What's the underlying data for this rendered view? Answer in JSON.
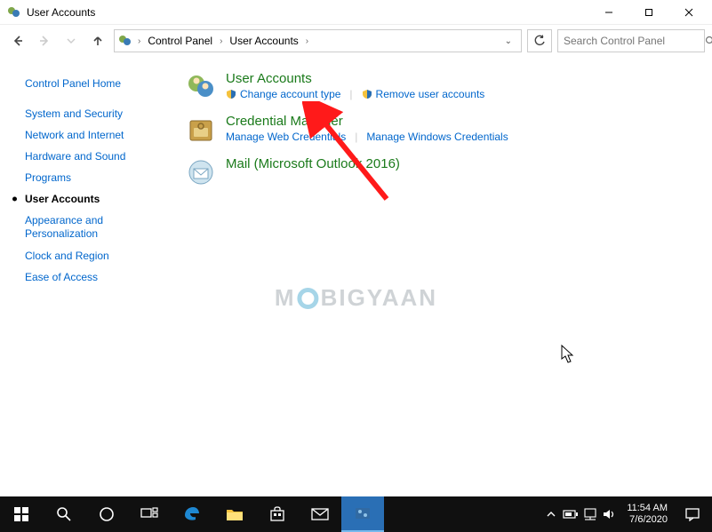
{
  "window": {
    "title": "User Accounts"
  },
  "nav": {
    "breadcrumb": [
      "Control Panel",
      "User Accounts"
    ],
    "search_placeholder": "Search Control Panel"
  },
  "sidebar": {
    "items": [
      {
        "label": "Control Panel Home",
        "current": false
      },
      {
        "label": "System and Security",
        "current": false
      },
      {
        "label": "Network and Internet",
        "current": false
      },
      {
        "label": "Hardware and Sound",
        "current": false
      },
      {
        "label": "Programs",
        "current": false
      },
      {
        "label": "User Accounts",
        "current": true
      },
      {
        "label": "Appearance and Personalization",
        "current": false
      },
      {
        "label": "Clock and Region",
        "current": false
      },
      {
        "label": "Ease of Access",
        "current": false
      }
    ]
  },
  "content": {
    "categories": [
      {
        "icon": "user-accounts-icon",
        "title": "User Accounts",
        "links": [
          {
            "label": "Change account type",
            "shield": true
          },
          {
            "label": "Remove user accounts",
            "shield": true
          }
        ]
      },
      {
        "icon": "credential-manager-icon",
        "title": "Credential Manager",
        "links": [
          {
            "label": "Manage Web Credentials",
            "shield": false
          },
          {
            "label": "Manage Windows Credentials",
            "shield": false
          }
        ]
      },
      {
        "icon": "mail-icon",
        "title": "Mail (Microsoft Outlook 2016)",
        "links": []
      }
    ]
  },
  "watermark": {
    "prefix": "M",
    "suffix": "BIGYAAN"
  },
  "annotation": {
    "arrow_target": "Manage Web Credentials"
  },
  "taskbar": {
    "buttons": [
      "start",
      "search",
      "cortana",
      "task-view",
      "edge",
      "file-explorer",
      "store",
      "mail",
      "control-panel"
    ],
    "active": "control-panel",
    "tray": [
      "chevron-up",
      "battery",
      "network",
      "volume"
    ],
    "time": "11:54 AM",
    "date": "7/6/2020"
  }
}
